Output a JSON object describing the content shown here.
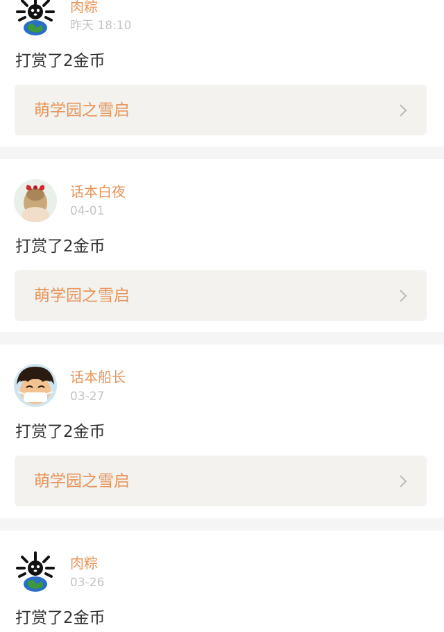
{
  "feed": {
    "entries": [
      {
        "username": "肉粽",
        "time": "昨天 18:10",
        "action": "打赏了2金币",
        "target": "萌学园之雪启",
        "avatar_icon": "globe-cartoon-icon"
      },
      {
        "username": "话本白夜",
        "time": "04-01",
        "action": "打赏了2金币",
        "target": "萌学园之雪启",
        "avatar_icon": "girl-red-bow-icon"
      },
      {
        "username": "话本船长",
        "time": "03-27",
        "action": "打赏了2金币",
        "target": "萌学园之雪启",
        "avatar_icon": "straw-hat-boy-icon"
      },
      {
        "username": "肉粽",
        "time": "03-26",
        "action": "打赏了2金币",
        "target": "",
        "avatar_icon": "globe-cartoon-icon"
      }
    ]
  },
  "colors": {
    "accent": "#e8945a",
    "muted": "#c4c4c4",
    "text": "#333333",
    "box_bg": "#f3f2ee",
    "separator": "#f5f5f5"
  }
}
